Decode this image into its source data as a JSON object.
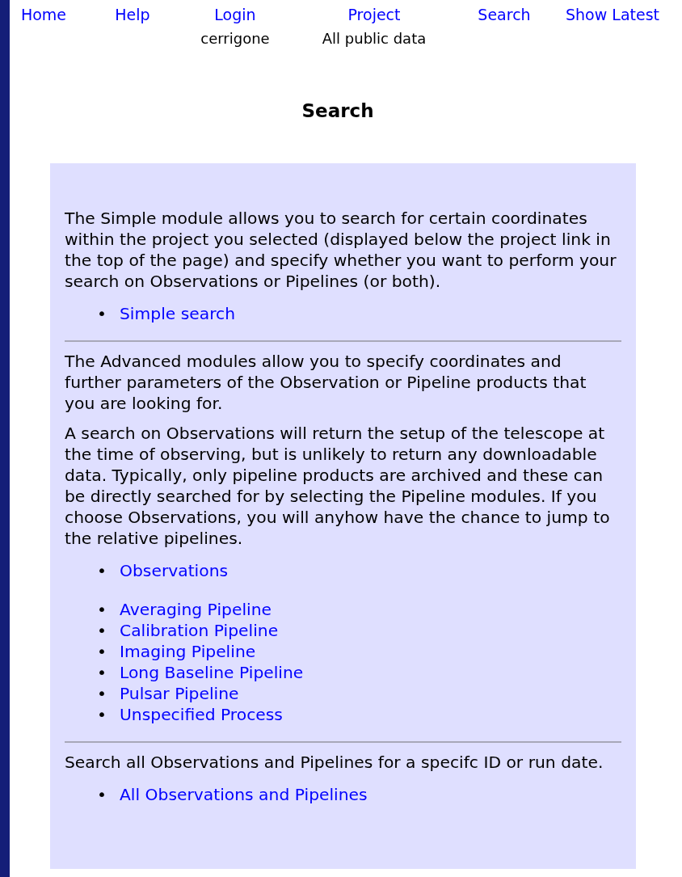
{
  "nav": [
    {
      "label": "Home"
    },
    {
      "label": "Help"
    },
    {
      "label": "Login",
      "sub": "cerrigone"
    },
    {
      "label": "Project",
      "sub": "All public data"
    },
    {
      "label": "Search"
    },
    {
      "label": "Show Latest"
    }
  ],
  "heading": "Search",
  "sections": [
    {
      "paragraphs": [
        "The Simple module allows you to search for certain coordinates within the project you selected (displayed below the project link in the top of the page) and specify whether you want to perform your search on Observations or Pipelines (or both)."
      ],
      "lists": [
        [
          {
            "bullet": "•",
            "label": "Simple search"
          }
        ]
      ]
    },
    {
      "paragraphs": [
        "The Advanced modules allow you to specify coordinates and further parameters of the Observation or Pipeline products that you are looking for.",
        "A search on Observations will return the setup of the telescope at the time of observing, but is unlikely to return any downloadable data. Typically, only pipeline products are archived and these can be directly searched for by selecting the Pipeline modules. If you choose Observations, you will anyhow have the chance to jump to the relative pipelines."
      ],
      "lists": [
        [
          {
            "bullet": "•",
            "label": "Observations"
          }
        ],
        [
          {
            "bullet": "•",
            "label": "Averaging Pipeline"
          },
          {
            "bullet": "•",
            "label": "Calibration Pipeline"
          },
          {
            "bullet": "•",
            "label": "Imaging Pipeline"
          },
          {
            "bullet": "•",
            "label": "Long Baseline Pipeline"
          },
          {
            "bullet": "•",
            "label": "Pulsar Pipeline"
          },
          {
            "bullet": "•",
            "label": "Unspecified Process"
          }
        ]
      ]
    },
    {
      "paragraphs": [
        "Search all Observations and Pipelines for a specifc ID or run date."
      ],
      "lists": [
        [
          {
            "bullet": "•",
            "label": "All Observations and Pipelines"
          }
        ]
      ]
    }
  ]
}
